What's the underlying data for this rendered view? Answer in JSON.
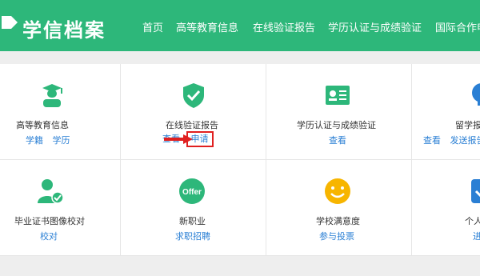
{
  "header": {
    "logo_text": "学信档案",
    "nav": [
      "首页",
      "高等教育信息",
      "在线验证报告",
      "学历认证与成绩验证",
      "国际合作申"
    ]
  },
  "cells": [
    {
      "title": "高等教育信息",
      "links": [
        "学籍",
        "学历"
      ],
      "icon": "graduate-icon"
    },
    {
      "title": "在线验证报告",
      "links": [
        "查看",
        "申请"
      ],
      "icon": "shield-check-icon"
    },
    {
      "title": "学历认证与成绩验证",
      "links": [
        "查看"
      ],
      "icon": "certificate-icon"
    },
    {
      "title": "留学报",
      "links": [
        "查看",
        "发送报告"
      ],
      "icon": "lightbulb-icon"
    },
    {
      "title": "毕业证书图像校对",
      "links": [
        "校对"
      ],
      "icon": "user-check-icon"
    },
    {
      "title": "新职业",
      "links": [
        "求职招聘"
      ],
      "icon": "offer-icon",
      "icon_text": "Offer"
    },
    {
      "title": "学校满意度",
      "links": [
        "参与投票"
      ],
      "icon": "smiley-icon"
    },
    {
      "title": "个人",
      "links": [
        "进"
      ],
      "icon": "blue-card-icon"
    }
  ],
  "colors": {
    "brand": "#2db77a",
    "link": "#2a7fd4",
    "highlight": "#e02020"
  }
}
